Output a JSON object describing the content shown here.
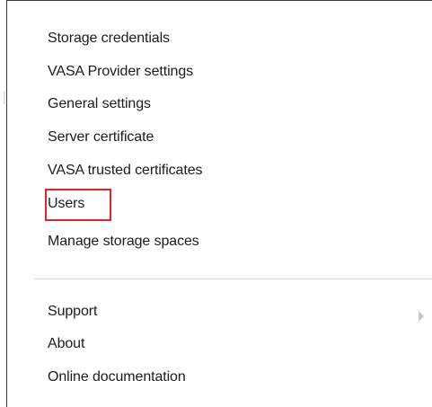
{
  "menu": {
    "items": [
      {
        "label": "Storage credentials"
      },
      {
        "label": "VASA Provider settings"
      },
      {
        "label": "General settings"
      },
      {
        "label": "Server certificate"
      },
      {
        "label": "VASA trusted certificates"
      },
      {
        "label": "Users"
      },
      {
        "label": "Manage storage spaces"
      }
    ],
    "secondary_items": [
      {
        "label": "Support",
        "has_submenu": true
      },
      {
        "label": "About"
      },
      {
        "label": "Online documentation"
      }
    ]
  },
  "icons": {
    "submenu": "chevron-right-icon"
  },
  "colors": {
    "highlight": "#e0242b",
    "text": "#1c1c1c",
    "divider": "#dcdcdc",
    "chevron": "#c7c7c7"
  }
}
